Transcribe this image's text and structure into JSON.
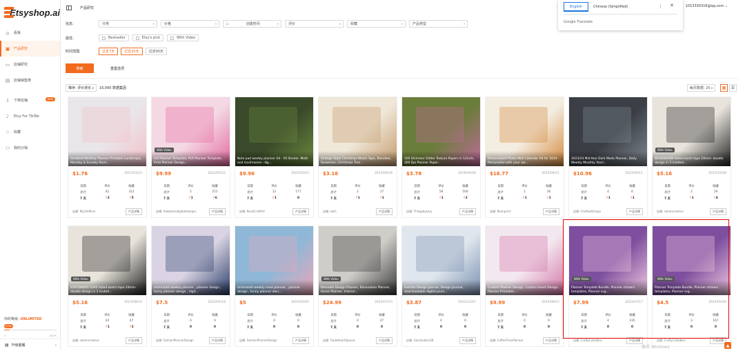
{
  "brand": {
    "name": "Etsyshop.ai"
  },
  "header": {
    "title": "产品研究",
    "user": "1013330316@qq.com"
  },
  "translate": {
    "tab_english": "English",
    "tab_chinese": "Chinese (Simplified)",
    "brand": "Google Translate"
  },
  "sidebar": {
    "items": [
      {
        "label": "看板",
        "icon": "dashboard-icon",
        "active": false
      },
      {
        "label": "产品研究",
        "icon": "bag-icon",
        "active": true
      },
      {
        "label": "店铺研究",
        "icon": "store-icon",
        "active": false
      },
      {
        "label": "店铺销售榜",
        "icon": "ranking-icon",
        "active": false
      },
      {
        "label": "下架店铺",
        "icon": "download-icon",
        "active": false,
        "badge": "NEW"
      },
      {
        "label": "Etsy For TikTok",
        "icon": "tiktok-icon",
        "active": false
      },
      {
        "label": "收藏",
        "icon": "star-icon",
        "active": false
      },
      {
        "label": "我的分销",
        "icon": "share-icon",
        "active": false
      }
    ],
    "level_label": "你的等级:",
    "level_value": "UNLIMITED",
    "level_tag": "¥100",
    "level_min": "1",
    "level_max": "200 K",
    "level_fill": 0.1,
    "upgrade": "升级套餐"
  },
  "filters": {
    "row1_label": "信息:",
    "selects": [
      "分类",
      "价格",
      "创建时间",
      "评价",
      "收藏",
      "产品类型"
    ],
    "row2_label": "属性:",
    "checks": [
      "Bestseller",
      "Etsy's pick",
      "With Video"
    ],
    "row3_label": "时间范围:",
    "ranges": [
      "过去7天",
      "过去30天",
      "过去90天"
    ],
    "search": "搜索",
    "reset": "重置选项"
  },
  "sortbar": {
    "sort": "降序: 评价增长",
    "count": "16,090 数据集因",
    "page_size": "每页数据: 20"
  },
  "stat_headers": [
    "日期",
    "评价",
    "收藏"
  ],
  "card_common": {
    "detail": "产品详情",
    "shop_prefix": "店铺: ",
    "with_video": "With Video",
    "row_total": "总计",
    "row_week": "7 天"
  },
  "cards": [
    {
      "title": "Undated Monthly Planner Printable Landscape, Monday & Sunday Start...",
      "price": "$1.76",
      "date": "2021/03/23",
      "reviews": "42",
      "favs": "312",
      "rw": "2",
      "fw": "5",
      "shop": "MyLifePlanr",
      "video": false,
      "bg": "#e9e6ea",
      "accent": "#f3c0c8"
    },
    {
      "title": "Girl Planner Template, PLR Planner Template, Print Planner Design...",
      "price": "$9.99",
      "date": "2022/02/22",
      "reviews": "5",
      "favs": "251",
      "rw": "1",
      "fw": "6",
      "shop": "thebolanadigitaldesigns",
      "video": true,
      "bg": "#f4d8e3",
      "accent": "#e46aa0"
    },
    {
      "title": "Note pad weekly planner A4 - 50 Sheets- Moth and mushrooms --8g...",
      "price": "$9.96",
      "date": "2023/02/03",
      "reviews": "12",
      "favs": "177",
      "rw": "1",
      "fw": "0",
      "shop": "PoxieCraftArt",
      "video": false,
      "bg": "#3a4a2a",
      "accent": "#6d8a3f"
    },
    {
      "title": "Vintage Style Christmas Washi Tape, Reindeer, Snowman, Christmas Tree...",
      "price": "$3.16",
      "date": "2023/09/28",
      "reviews": "2",
      "favs": "17",
      "rw": "1",
      "fw": "1",
      "shop": "zolili",
      "video": false,
      "bg": "#efe7d7",
      "accent": "#c49a6c"
    },
    {
      "title": "100 Shimmer Glitter Texture Papers in 12inch, 300 Dpi Planner Paper...",
      "price": "$3.78",
      "date": "2018/04/06",
      "reviews": "58",
      "favs": "500",
      "rw": "1",
      "fw": "2",
      "shop": "ThingsbyLary",
      "video": false,
      "bg": "#6b7d3a",
      "accent": "#c26aa0"
    },
    {
      "title": "Personalised Photo Wall Calendar A4 for 2024 - Personalise with your ow...",
      "price": "$16.77",
      "date": "2023/09/21",
      "reviews": "1",
      "favs": "16",
      "rw": "1",
      "fw": "1",
      "shop": "Beanprint",
      "video": false,
      "bg": "#f4ede2",
      "accent": "#d58a3c"
    },
    {
      "title": "2023/24 Mid-Year Dark Mode Planner, Daily Weekly Monthly Yearl...",
      "price": "$10.96",
      "date": "2023/09/11",
      "reviews": "4",
      "favs": "6",
      "rw": "1",
      "fw": "1",
      "shop": "ChaftanDesign",
      "video": false,
      "bg": "#3b3f45",
      "accent": "#7f8790"
    },
    {
      "title": "BOOKWORM foiled washi tape 20mm- doodle design in 3 molded...",
      "price": "$5.16",
      "date": "2023/10/28",
      "reviews": "2",
      "favs": "19",
      "rw": "1",
      "fw": "4",
      "shop": "salamcreative",
      "video": true,
      "bg": "#e8e4dc",
      "accent": "#222"
    },
    {
      "title": "STATIONERY LOVE foiled washi tape 20mm- doodle design in 3 muted...",
      "price": "$5.16",
      "date": "2023/08/14",
      "reviews": "20",
      "favs": "47",
      "rw": "1",
      "fw": "2",
      "shop": "salamcreative",
      "video": true,
      "bg": "#e8e4dc",
      "accent": "#222"
    },
    {
      "title": "minimalist weekly planner , planner design , funny planner design , digit...",
      "price": "$7.5",
      "date": "2023/05/18",
      "reviews": "0",
      "favs": "0",
      "rw": "0",
      "fw": "0",
      "shop": "FashionPlannerDesign",
      "video": false,
      "bg": "#d9d3e3",
      "accent": "#2b3e6a"
    },
    {
      "title": "minimalist weekly meal planner , planner design , funny planner desi...",
      "price": "$5",
      "date": "2023/05/05",
      "reviews": "0",
      "favs": "0",
      "rw": "0",
      "fw": "0",
      "shop": "FashionPlannerDesign",
      "video": false,
      "bg": "#8fb8d8",
      "accent": "#e9a6b8"
    },
    {
      "title": "Remodel Design Planner, Renovation Planner, Home Planner, Interior...",
      "price": "$24.99",
      "date": "2023/07/23",
      "reviews": "0",
      "favs": "27",
      "rw": "0",
      "fw": "0",
      "shop": "TripleHeartSpaces",
      "video": true,
      "bg": "#cfcdc8",
      "accent": "#3a3a3a"
    },
    {
      "title": "Fashion Design Journal, Design Journal, downloadable digital journ...",
      "price": "$3.87",
      "date": "2022/12/07",
      "reviews": "0",
      "favs": "0",
      "rw": "0",
      "fw": "0",
      "shop": "GulsstudiosGB",
      "video": false,
      "bg": "#dfe6ee",
      "accent": "#7a8fb0"
    },
    {
      "title": "Custom Planner Design, Custom Insert Design, Planner Printable,...",
      "price": "$9.99",
      "date": "2023/08/15",
      "reviews": "0",
      "favs": "0",
      "rw": "0",
      "fw": "0",
      "shop": "CoffeeTimePlanner",
      "video": false,
      "bg": "#f3e8ef",
      "accent": "#d474a8"
    },
    {
      "title": "Planner Template Bundle, Planner stickers templates, Planner svg...",
      "price": "$7.99",
      "date": "2023/07/17",
      "reviews": "4",
      "favs": "235",
      "rw": "0",
      "fw": "0",
      "shop": "CraftyCuttables",
      "video": true,
      "bg": "#7d4f9e",
      "accent": "#f0c8e0"
    },
    {
      "title": "Planner Template Bundle, Planner stickers templates, Planner svg...",
      "price": "$4.5",
      "date": "2023/05/04",
      "reviews": "3",
      "favs": "167",
      "rw": "0",
      "fw": "0",
      "shop": "CraftyCuttables",
      "video": true,
      "bg": "#7d4f9e",
      "accent": "#f0c8e0"
    }
  ],
  "watermark": "激活 Windows"
}
